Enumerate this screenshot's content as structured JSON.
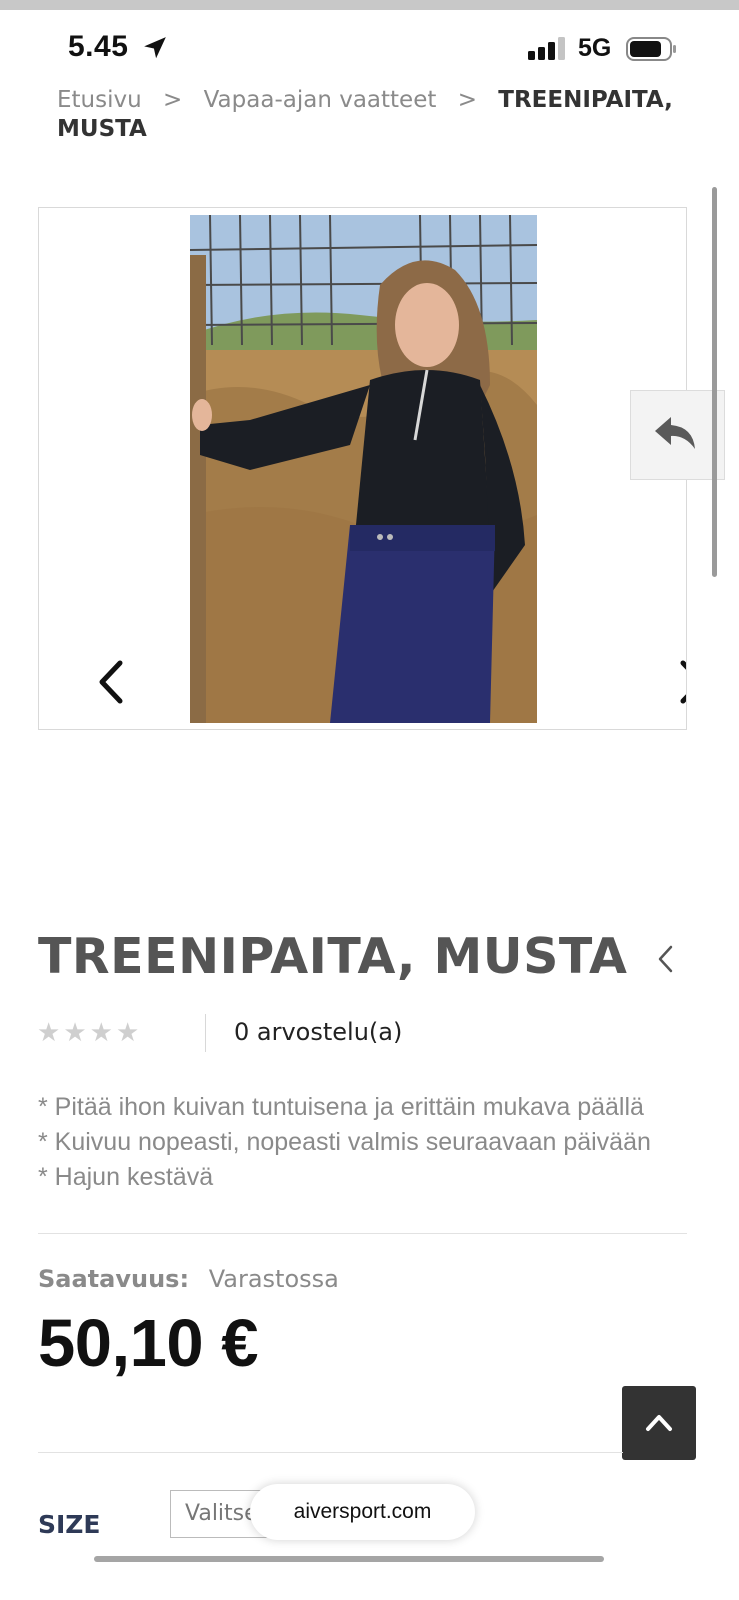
{
  "status_bar": {
    "time": "5.45",
    "network": "5G",
    "icons": [
      "location-arrow-icon",
      "signal-bars-icon",
      "battery-icon"
    ]
  },
  "breadcrumb": {
    "items": [
      "Etusivu",
      "Vapaa-ajan vaatteet"
    ],
    "current": "TREENIPAITA, MUSTA",
    "separator": ">"
  },
  "gallery": {
    "icons": [
      "chevron-left-icon",
      "chevron-right-icon",
      "reply-icon"
    ]
  },
  "product": {
    "title": "TREENIPAITA, MUSTA",
    "rating": {
      "stars_filled": 0,
      "stars_total": 4,
      "reviews_label": "0 arvostelu(a)"
    },
    "features": [
      "* Pitää ihon kuivan tuntuisena ja erittäin mukava päällä",
      "* Kuivuu nopeasti, nopeasti valmis seuraavaan päivään",
      "* Hajun kestävä"
    ],
    "availability_label": "Saatavuus:",
    "availability_value": "Varastossa",
    "price": "50,10 €",
    "size_label": "SIZE",
    "size_select_value": "Valitse"
  },
  "browser": {
    "url": "aiversport.com"
  },
  "colors": {
    "price": "#111111",
    "title": "#555555",
    "size_label": "#2e3a57",
    "scroll_top_bg": "#333333"
  }
}
